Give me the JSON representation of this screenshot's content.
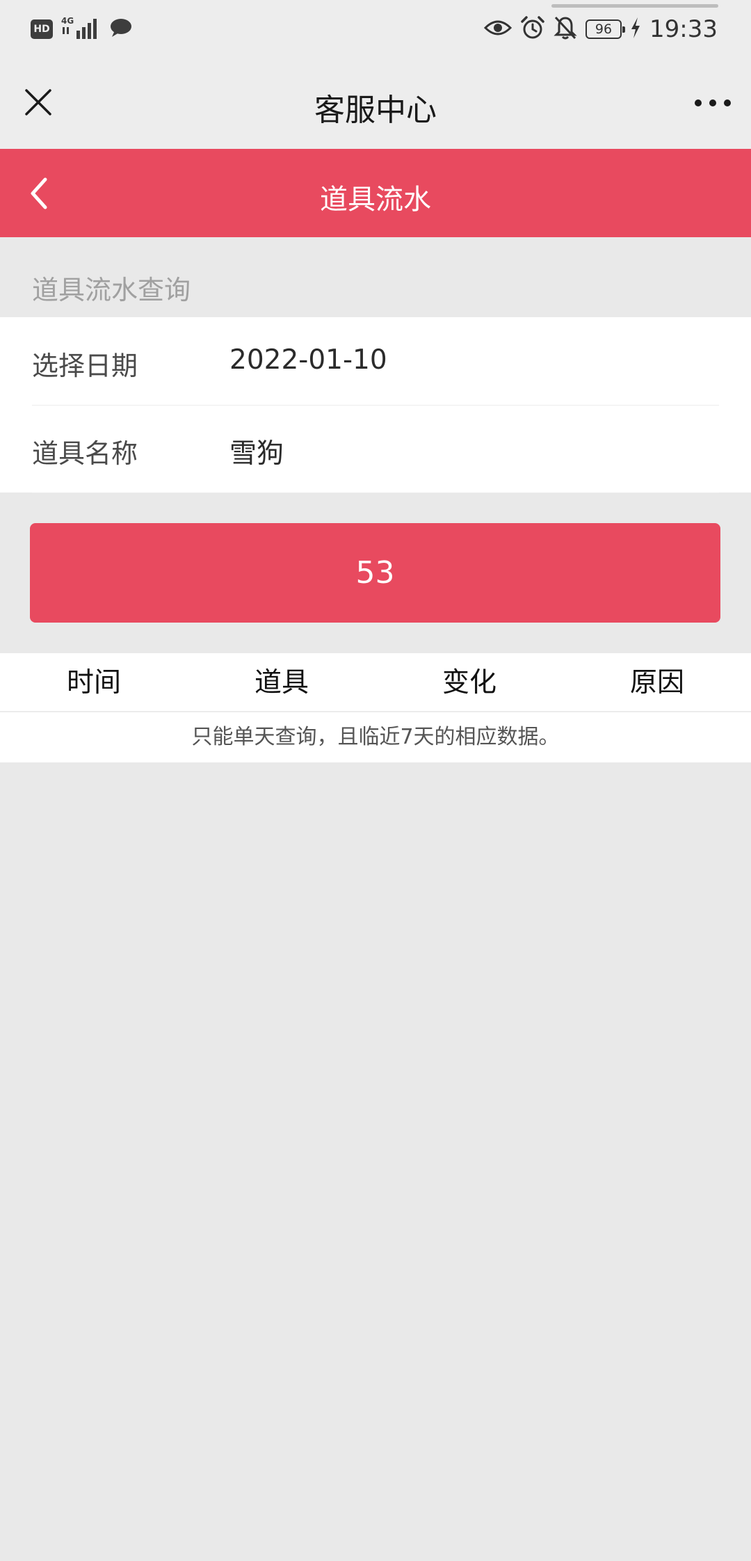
{
  "status_bar": {
    "hd_badge": "HD",
    "network": "4G",
    "battery": "96",
    "time": "19:33"
  },
  "title_bar": {
    "title": "客服中心"
  },
  "header": {
    "title": "道具流水"
  },
  "section": {
    "caption": "道具流水查询"
  },
  "form": {
    "date_label": "选择日期",
    "date_value": "2022-01-10",
    "item_label": "道具名称",
    "item_value": "雪狗"
  },
  "submit_button": {
    "label": "53"
  },
  "table": {
    "columns": [
      "时间",
      "道具",
      "变化",
      "原因"
    ],
    "note": "只能单天查询，且临近7天的相应数据。"
  },
  "colors": {
    "accent": "#e84a5f",
    "background": "#e9e9e9"
  }
}
